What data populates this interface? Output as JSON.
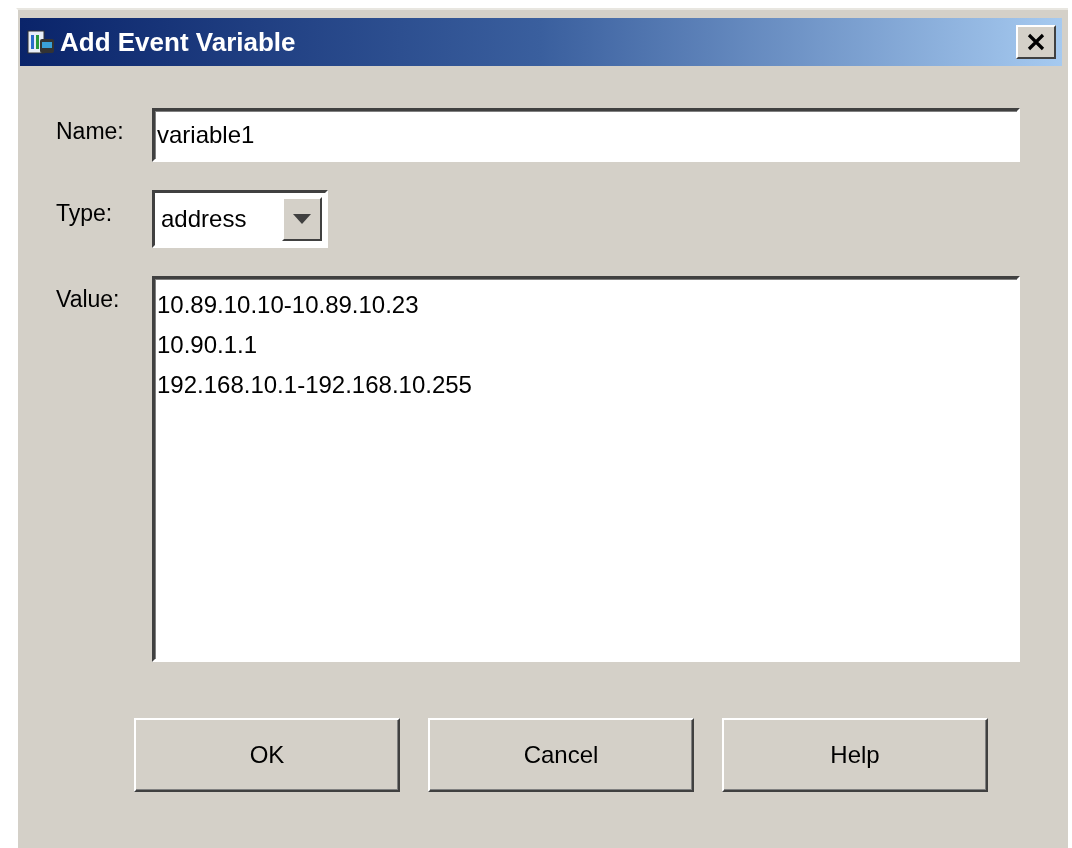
{
  "window": {
    "title": "Add Event Variable"
  },
  "fields": [
    {
      "label": "Name:",
      "kind": "text",
      "value": "variable1"
    },
    {
      "label": "Type:",
      "kind": "combo",
      "value": "address"
    },
    {
      "label": "Value:",
      "kind": "multiline",
      "value": "10.89.10.10-10.89.10.23\n10.90.1.1\n192.168.10.1-192.168.10.255"
    }
  ],
  "buttons": [
    "OK",
    "Cancel",
    "Help"
  ]
}
